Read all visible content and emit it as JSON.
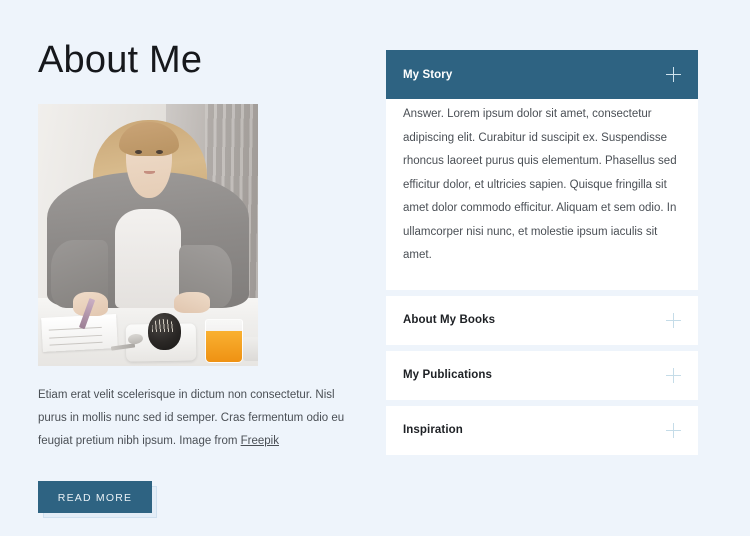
{
  "page": {
    "background_color": "#eef4fb",
    "accent_color": "#2e6382",
    "plus_icon_color": "#c5dce8"
  },
  "left": {
    "title": "About Me",
    "photo_alt": "Woman in grey blazer writing in a notebook at a breakfast table",
    "paragraph_before_link": "Etiam erat velit scelerisque in dictum non consectetur. Nisl purus in mollis nunc sed id semper. Cras fermentum odio eu feugiat pretium nibh ipsum. Image from ",
    "link_text": "Freepik",
    "button_label": "READ MORE"
  },
  "accordion": {
    "items": [
      {
        "title": "My Story",
        "expanded": true,
        "icon": "plus-icon",
        "body": "Answer. Lorem ipsum dolor sit amet, consectetur adipiscing elit. Curabitur id suscipit ex. Suspendisse rhoncus laoreet purus quis elementum. Phasellus sed efficitur dolor, et ultricies sapien. Quisque fringilla sit amet dolor commodo efficitur. Aliquam et sem odio. In ullamcorper nisi nunc, et molestie ipsum iaculis sit amet."
      },
      {
        "title": "About My Books",
        "expanded": false,
        "icon": "plus-icon",
        "body": ""
      },
      {
        "title": "My Publications",
        "expanded": false,
        "icon": "plus-icon",
        "body": ""
      },
      {
        "title": "Inspiration",
        "expanded": false,
        "icon": "plus-icon",
        "body": ""
      }
    ]
  }
}
